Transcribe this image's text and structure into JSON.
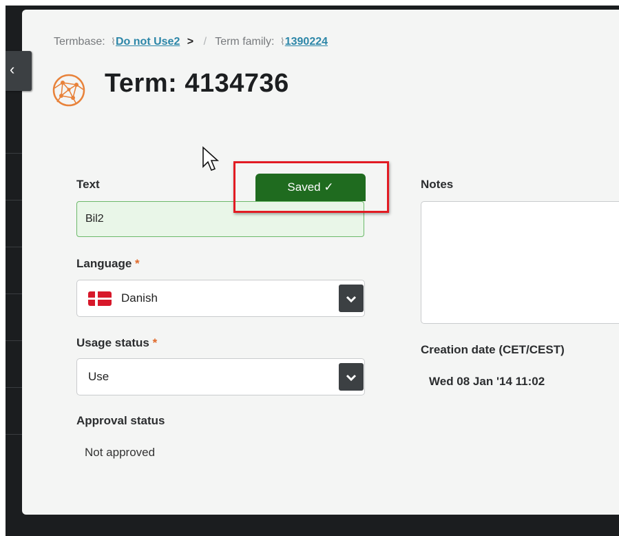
{
  "breadcrumb": {
    "termbase_label": "Termbase:",
    "termbase_link": "Do not Use2",
    "arrow": ">",
    "separator": "/",
    "family_label": "Term family:",
    "family_link": "1390224"
  },
  "header": {
    "title": "Term: 4134736",
    "icon": "globe-network-icon"
  },
  "form": {
    "text_label": "Text",
    "text_value": "Bil2",
    "saved_label": "Saved ✓",
    "language_label": "Language",
    "language_value": "Danish",
    "usage_label": "Usage status",
    "usage_value": "Use",
    "approval_label": "Approval status",
    "approval_value": "Not approved",
    "required_mark": "*"
  },
  "side": {
    "notes_label": "Notes",
    "notes_value": "",
    "creation_label": "Creation date (CET/CEST)",
    "creation_value": "Wed 08 Jan '14 11:02"
  },
  "colors": {
    "saved_green": "#1f6b1f",
    "highlight_red": "#e21b23",
    "link_blue": "#2c86a8",
    "required_orange": "#e0692a"
  }
}
